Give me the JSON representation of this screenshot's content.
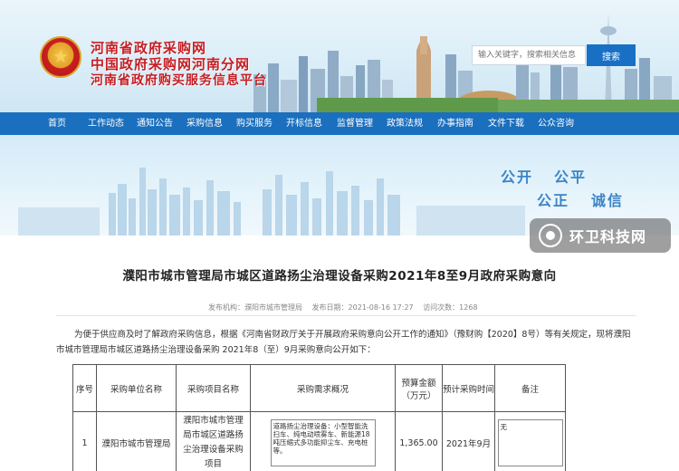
{
  "header": {
    "title_line1": "河南省政府采购网",
    "title_line2": "中国政府采购网河南分网",
    "title_line3": "河南省政府购买服务信息平台",
    "search_placeholder": "输入关键字，搜索相关信息",
    "search_button": "搜索"
  },
  "nav": {
    "items": [
      "首页",
      "工作动态",
      "通知公告",
      "采购信息",
      "购买服务",
      "开标信息",
      "监督管理",
      "政策法规",
      "办事指南",
      "文件下载",
      "公众咨询"
    ]
  },
  "banner": {
    "slogan_1": "公开",
    "slogan_2": "公平",
    "slogan_3": "公正",
    "slogan_4": "诚信"
  },
  "watermark": {
    "text": "环卫科技网"
  },
  "article": {
    "title": "濮阳市城市管理局市城区道路扬尘治理设备采购2021年8至9月政府采购意向",
    "meta_org": "发布机构：濮阳市城市管理局",
    "meta_date": "发布日期：2021-08-16 17:27",
    "meta_views": "访问次数：1268",
    "paragraph": "为便于供应商及时了解政府采购信息，根据《河南省财政厅关于开展政府采购意向公开工作的通知》（豫财购【2020】8号）等有关规定，现将濮阳市城市管理局市城区道路扬尘治理设备采购 2021年8（至）9月采购意向公开如下："
  },
  "table": {
    "headers": [
      "序号",
      "采购单位名称",
      "采购项目名称",
      "采购需求概况",
      "预算金额（万元）",
      "预计采购时间",
      "备注"
    ],
    "rows": [
      {
        "no": "1",
        "unit": "濮阳市城市管理局",
        "project": "濮阳市城市管理局市城区道路扬尘治理设备采购项目",
        "requirement": "道路扬尘治理设备：小型智能洗扫车、纯电动喷雾车、新能源18吨压缩式多功能抑尘车、充电桩等。",
        "budget": "1,365.00",
        "time": "2021年9月",
        "note": "无"
      }
    ]
  }
}
